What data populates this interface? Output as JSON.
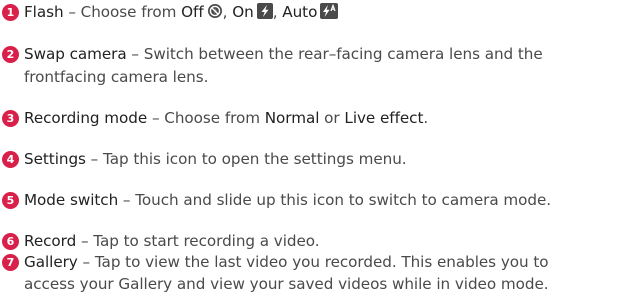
{
  "items": [
    {
      "num": "1",
      "term": "Flash",
      "dash": " – Choose from ",
      "opt1": "Off",
      "sep1": ", ",
      "opt2": "On",
      "sep2": ", ",
      "opt3": "Auto",
      "flash_off_icon": "flash-off-icon",
      "flash_on_icon": "flash-on-icon",
      "flash_auto_icon": "flash-auto-icon"
    },
    {
      "num": "2",
      "term": "Swap camera",
      "line1": " – Switch between the rear–facing camera lens and the",
      "line2": "frontfacing camera lens."
    },
    {
      "num": "3",
      "term": "Recording mode",
      "dash": " – Choose from ",
      "opt1": "Normal",
      "mid": " or ",
      "opt2": "Live effect",
      "end": "."
    },
    {
      "num": "4",
      "term": "Settings",
      "rest": " – Tap this icon to open the settings menu."
    },
    {
      "num": "5",
      "term": "Mode switch",
      "rest": " – Touch and slide up this icon to switch to camera mode."
    },
    {
      "num": "6",
      "term": "Record",
      "rest": " – Tap to start recording a video."
    },
    {
      "num": "7",
      "term": "Gallery",
      "line1": " – Tap to view the last video you recorded. This enables you to",
      "line2": "access your Gallery and view your saved videos while in video mode."
    }
  ],
  "colors": {
    "badge": "#d8204a",
    "text": "#4a4a4a",
    "emphasis": "#222222",
    "icon_bg": "#4a4a4a"
  }
}
